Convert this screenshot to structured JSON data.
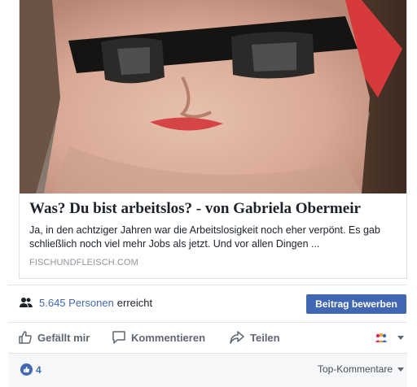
{
  "link_preview": {
    "title": "Was? Du bist arbeitslos? - von Gabriela Obermeir",
    "description": "Ja, in den achtziger Jahren war die Arbeitslosigkeit noch eher verpönt. Es gab schließlich noch viel mehr Jobs als jetzt. Und vor allen Dingen ...",
    "domain": "FISCHUNDFLEISCH.COM",
    "image_icon": "portrait-photo"
  },
  "reach": {
    "icon": "people-icon",
    "count": "5.645 Personen",
    "label": "erreicht"
  },
  "promote_button": "Beitrag bewerben",
  "actions": {
    "like": "Gefällt mir",
    "comment": "Kommentieren",
    "share": "Teilen"
  },
  "footer": {
    "like_count": "4",
    "sort_label": "Top-Kommentare"
  },
  "colors": {
    "brand": "#4267b2",
    "action_text": "#606770",
    "muted": "#90949c"
  }
}
